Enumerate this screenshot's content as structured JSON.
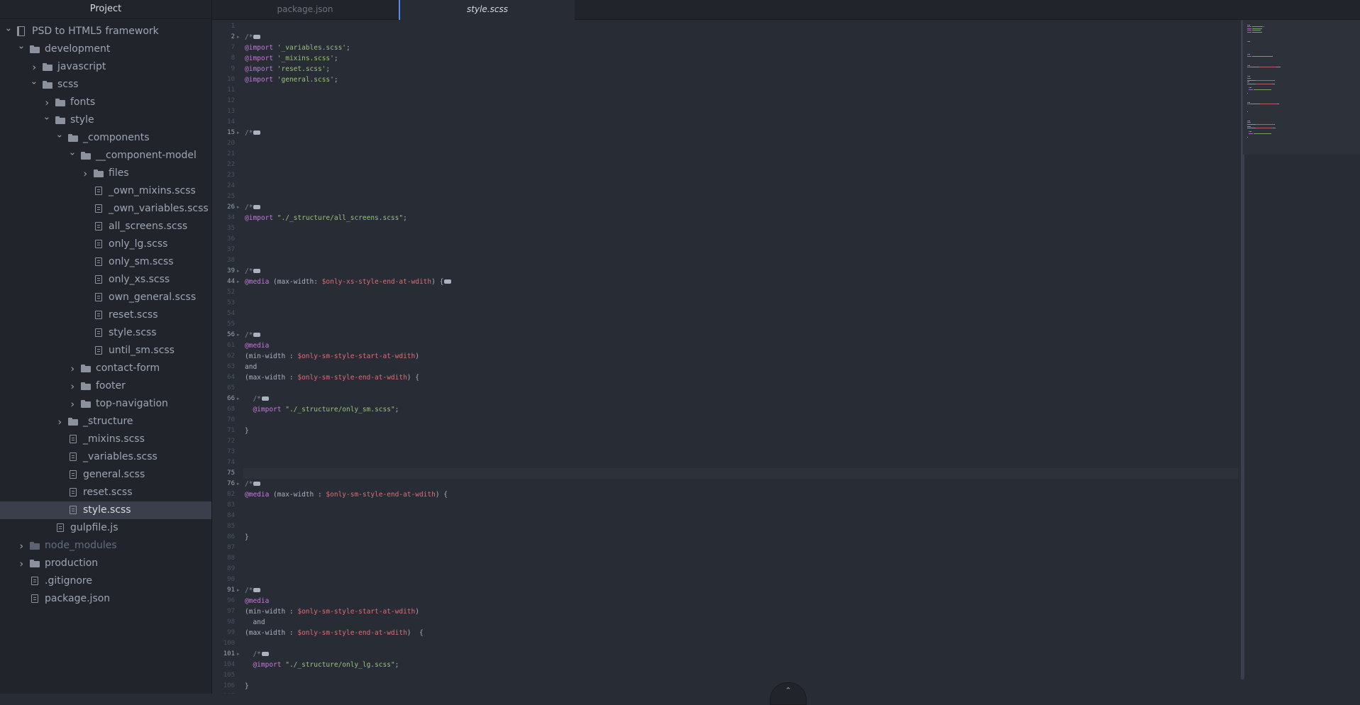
{
  "sidebar": {
    "title": "Project",
    "tree": [
      {
        "label": "PSD to HTML5 framework",
        "type": "repo",
        "depth": 0,
        "expanded": true
      },
      {
        "label": "development",
        "type": "folder",
        "depth": 1,
        "expanded": true
      },
      {
        "label": "javascript",
        "type": "folder",
        "depth": 2,
        "expanded": false
      },
      {
        "label": "scss",
        "type": "folder",
        "depth": 2,
        "expanded": true
      },
      {
        "label": "fonts",
        "type": "folder",
        "depth": 3,
        "expanded": false
      },
      {
        "label": "style",
        "type": "folder",
        "depth": 3,
        "expanded": true
      },
      {
        "label": "_components",
        "type": "folder",
        "depth": 4,
        "expanded": true
      },
      {
        "label": "__component-model",
        "type": "folder",
        "depth": 5,
        "expanded": true
      },
      {
        "label": "files",
        "type": "folder",
        "depth": 6,
        "expanded": false
      },
      {
        "label": "_own_mixins.scss",
        "type": "file",
        "depth": 6
      },
      {
        "label": "_own_variables.scss",
        "type": "file",
        "depth": 6
      },
      {
        "label": "all_screens.scss",
        "type": "file",
        "depth": 6
      },
      {
        "label": "only_lg.scss",
        "type": "file",
        "depth": 6
      },
      {
        "label": "only_sm.scss",
        "type": "file",
        "depth": 6
      },
      {
        "label": "only_xs.scss",
        "type": "file",
        "depth": 6
      },
      {
        "label": "own_general.scss",
        "type": "file",
        "depth": 6
      },
      {
        "label": "reset.scss",
        "type": "file",
        "depth": 6
      },
      {
        "label": "style.scss",
        "type": "file",
        "depth": 6
      },
      {
        "label": "until_sm.scss",
        "type": "file",
        "depth": 6
      },
      {
        "label": "contact-form",
        "type": "folder",
        "depth": 5,
        "expanded": false
      },
      {
        "label": "footer",
        "type": "folder",
        "depth": 5,
        "expanded": false
      },
      {
        "label": "top-navigation",
        "type": "folder",
        "depth": 5,
        "expanded": false
      },
      {
        "label": "_structure",
        "type": "folder",
        "depth": 4,
        "expanded": false
      },
      {
        "label": "_mixins.scss",
        "type": "file",
        "depth": 4
      },
      {
        "label": "_variables.scss",
        "type": "file",
        "depth": 4
      },
      {
        "label": "general.scss",
        "type": "file",
        "depth": 4
      },
      {
        "label": "reset.scss",
        "type": "file",
        "depth": 4
      },
      {
        "label": "style.scss",
        "type": "file",
        "depth": 4,
        "selected": true
      },
      {
        "label": "gulpfile.js",
        "type": "file",
        "depth": 3
      },
      {
        "label": "node_modules",
        "type": "folder",
        "depth": 1,
        "expanded": false,
        "ignored": true
      },
      {
        "label": "production",
        "type": "folder",
        "depth": 1,
        "expanded": false
      },
      {
        "label": ".gitignore",
        "type": "file",
        "depth": 1
      },
      {
        "label": "package.json",
        "type": "file",
        "depth": 1
      }
    ]
  },
  "tabs": [
    {
      "label": "package.json",
      "active": false
    },
    {
      "label": "style.scss",
      "active": true
    }
  ],
  "editor": {
    "cursor_line": "75",
    "lines": [
      {
        "n": "1",
        "tokens": []
      },
      {
        "n": "2",
        "fold": true,
        "tokens": [
          {
            "c": "cm",
            "t": "/*"
          },
          {
            "c": "box",
            "t": ""
          }
        ]
      },
      {
        "n": "7",
        "tokens": [
          {
            "c": "kw",
            "t": "@import"
          },
          {
            "c": "pl",
            "t": " "
          },
          {
            "c": "str",
            "t": "'_variables.scss'"
          },
          {
            "c": "pl",
            "t": ";"
          }
        ]
      },
      {
        "n": "8",
        "tokens": [
          {
            "c": "kw",
            "t": "@import"
          },
          {
            "c": "pl",
            "t": " "
          },
          {
            "c": "str",
            "t": "'_mixins.scss'"
          },
          {
            "c": "pl",
            "t": ";"
          }
        ]
      },
      {
        "n": "9",
        "tokens": [
          {
            "c": "kw",
            "t": "@import"
          },
          {
            "c": "pl",
            "t": " "
          },
          {
            "c": "str",
            "t": "'reset.scss'"
          },
          {
            "c": "pl",
            "t": ";"
          }
        ]
      },
      {
        "n": "10",
        "tokens": [
          {
            "c": "kw",
            "t": "@import"
          },
          {
            "c": "pl",
            "t": " "
          },
          {
            "c": "str",
            "t": "'general.scss'"
          },
          {
            "c": "pl",
            "t": ";"
          }
        ]
      },
      {
        "n": "11",
        "tokens": []
      },
      {
        "n": "12",
        "tokens": []
      },
      {
        "n": "13",
        "tokens": []
      },
      {
        "n": "14",
        "tokens": []
      },
      {
        "n": "15",
        "fold": true,
        "tokens": [
          {
            "c": "cm",
            "t": "/*"
          },
          {
            "c": "box",
            "t": ""
          }
        ]
      },
      {
        "n": "20",
        "tokens": []
      },
      {
        "n": "21",
        "tokens": []
      },
      {
        "n": "22",
        "tokens": []
      },
      {
        "n": "23",
        "tokens": []
      },
      {
        "n": "24",
        "tokens": []
      },
      {
        "n": "25",
        "tokens": []
      },
      {
        "n": "26",
        "fold": true,
        "tokens": [
          {
            "c": "cm",
            "t": "/*"
          },
          {
            "c": "box",
            "t": ""
          }
        ]
      },
      {
        "n": "34",
        "tokens": [
          {
            "c": "kw",
            "t": "@import"
          },
          {
            "c": "pl",
            "t": " "
          },
          {
            "c": "str",
            "t": "\"./_structure/all_screens.scss\""
          },
          {
            "c": "pl",
            "t": ";"
          }
        ]
      },
      {
        "n": "35",
        "tokens": []
      },
      {
        "n": "36",
        "tokens": []
      },
      {
        "n": "37",
        "tokens": []
      },
      {
        "n": "38",
        "tokens": []
      },
      {
        "n": "39",
        "fold": true,
        "tokens": [
          {
            "c": "cm",
            "t": "/*"
          },
          {
            "c": "box",
            "t": ""
          }
        ]
      },
      {
        "n": "44",
        "fold": true,
        "tokens": [
          {
            "c": "kw",
            "t": "@media"
          },
          {
            "c": "pl",
            "t": " (max-width: "
          },
          {
            "c": "var",
            "t": "$only-xs-style-end-at-wdith"
          },
          {
            "c": "pl",
            "t": ") {"
          },
          {
            "c": "box",
            "t": ""
          }
        ]
      },
      {
        "n": "52",
        "tokens": []
      },
      {
        "n": "53",
        "tokens": []
      },
      {
        "n": "54",
        "tokens": []
      },
      {
        "n": "55",
        "tokens": []
      },
      {
        "n": "56",
        "fold": true,
        "tokens": [
          {
            "c": "cm",
            "t": "/*"
          },
          {
            "c": "box",
            "t": ""
          }
        ]
      },
      {
        "n": "61",
        "tokens": [
          {
            "c": "kw",
            "t": "@media"
          }
        ]
      },
      {
        "n": "62",
        "tokens": [
          {
            "c": "pl",
            "t": "(min-width : "
          },
          {
            "c": "var",
            "t": "$only-sm-style-start-at-wdith"
          },
          {
            "c": "pl",
            "t": ")"
          }
        ]
      },
      {
        "n": "63",
        "tokens": [
          {
            "c": "pl",
            "t": "and"
          }
        ]
      },
      {
        "n": "64",
        "tokens": [
          {
            "c": "pl",
            "t": "(max-width : "
          },
          {
            "c": "var",
            "t": "$only-sm-style-end-at-wdith"
          },
          {
            "c": "pl",
            "t": ") {"
          }
        ]
      },
      {
        "n": "65",
        "tokens": []
      },
      {
        "n": "66",
        "fold": true,
        "tokens": [
          {
            "c": "pl",
            "t": "  "
          },
          {
            "c": "cm",
            "t": "/*"
          },
          {
            "c": "box",
            "t": ""
          }
        ]
      },
      {
        "n": "68",
        "tokens": [
          {
            "c": "pl",
            "t": "  "
          },
          {
            "c": "kw",
            "t": "@import"
          },
          {
            "c": "pl",
            "t": " "
          },
          {
            "c": "str",
            "t": "\"./_structure/only_sm.scss\""
          },
          {
            "c": "pl",
            "t": ";"
          }
        ]
      },
      {
        "n": "70",
        "tokens": []
      },
      {
        "n": "71",
        "tokens": [
          {
            "c": "pl",
            "t": "}"
          }
        ]
      },
      {
        "n": "72",
        "tokens": []
      },
      {
        "n": "73",
        "tokens": []
      },
      {
        "n": "74",
        "tokens": []
      },
      {
        "n": "75",
        "tokens": []
      },
      {
        "n": "76",
        "fold": true,
        "tokens": [
          {
            "c": "cm",
            "t": "/*"
          },
          {
            "c": "box",
            "t": ""
          }
        ]
      },
      {
        "n": "82",
        "tokens": [
          {
            "c": "kw",
            "t": "@media"
          },
          {
            "c": "pl",
            "t": " (max-width : "
          },
          {
            "c": "var",
            "t": "$only-sm-style-end-at-wdith"
          },
          {
            "c": "pl",
            "t": ") {"
          }
        ]
      },
      {
        "n": "83",
        "tokens": []
      },
      {
        "n": "84",
        "tokens": []
      },
      {
        "n": "85",
        "tokens": []
      },
      {
        "n": "86",
        "tokens": [
          {
            "c": "pl",
            "t": "}"
          }
        ]
      },
      {
        "n": "87",
        "tokens": []
      },
      {
        "n": "88",
        "tokens": []
      },
      {
        "n": "89",
        "tokens": []
      },
      {
        "n": "90",
        "tokens": []
      },
      {
        "n": "91",
        "fold": true,
        "tokens": [
          {
            "c": "cm",
            "t": "/*"
          },
          {
            "c": "box",
            "t": ""
          }
        ]
      },
      {
        "n": "96",
        "tokens": [
          {
            "c": "kw",
            "t": "@media"
          }
        ]
      },
      {
        "n": "97",
        "tokens": [
          {
            "c": "pl",
            "t": "(min-width : "
          },
          {
            "c": "var",
            "t": "$only-sm-style-start-at-wdith"
          },
          {
            "c": "pl",
            "t": ")"
          }
        ]
      },
      {
        "n": "98",
        "tokens": [
          {
            "c": "pl",
            "t": "  and"
          }
        ]
      },
      {
        "n": "99",
        "tokens": [
          {
            "c": "pl",
            "t": "(max-width : "
          },
          {
            "c": "var",
            "t": "$only-sm-style-end-at-wdith"
          },
          {
            "c": "pl",
            "t": ")  {"
          }
        ]
      },
      {
        "n": "100",
        "tokens": []
      },
      {
        "n": "101",
        "fold": true,
        "tokens": [
          {
            "c": "pl",
            "t": "  "
          },
          {
            "c": "cm",
            "t": "/*"
          },
          {
            "c": "box",
            "t": ""
          }
        ]
      },
      {
        "n": "104",
        "tokens": [
          {
            "c": "pl",
            "t": "  "
          },
          {
            "c": "kw",
            "t": "@import"
          },
          {
            "c": "pl",
            "t": " "
          },
          {
            "c": "str",
            "t": "\"./_structure/only_lg.scss\""
          },
          {
            "c": "pl",
            "t": ";"
          }
        ]
      },
      {
        "n": "105",
        "tokens": []
      },
      {
        "n": "106",
        "tokens": [
          {
            "c": "pl",
            "t": "}"
          }
        ]
      },
      {
        "n": "107",
        "tokens": []
      }
    ]
  },
  "colors": {
    "background": "#282c34",
    "sidebar": "#21252b",
    "accent": "#568af2",
    "keyword": "#c678dd",
    "string": "#98c379",
    "variable": "#e06c75",
    "comment": "#7f848e"
  },
  "icons": {
    "repo": "repo-icon",
    "folder": "folder-icon",
    "file": "file-text-icon",
    "chevron_right": "chevron-right-icon",
    "chevron_down": "chevron-down-icon",
    "scroll_bottom": "chevron-up-icon"
  },
  "scroll_button_glyph": "⌃"
}
